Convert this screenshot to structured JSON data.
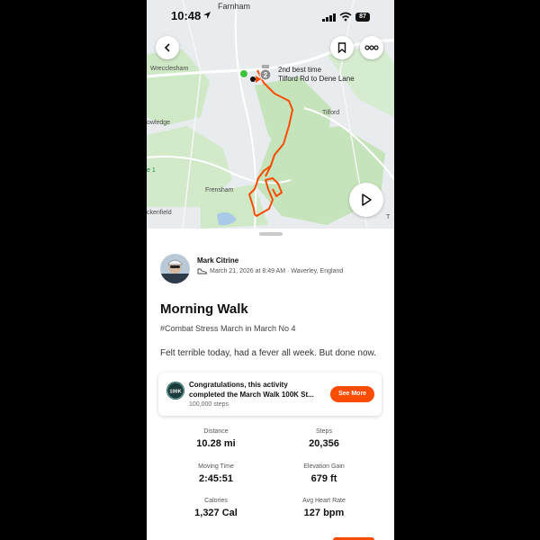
{
  "status": {
    "time": "10:48",
    "battery": "87"
  },
  "map": {
    "labels": {
      "farnham": "Farnham",
      "wrecclesham": "Wrecclesham",
      "tilford": "Tilford",
      "rowledge": "owledge",
      "frensham": "Frensham",
      "churt": "ckenfield",
      "route1": "e 1",
      "edge": "T"
    },
    "segment": {
      "rank": "2",
      "line1": "2nd best time",
      "line2": "Tilford Rd to Dene Lane"
    }
  },
  "activity": {
    "athlete": "Mark Citrine",
    "date_location": "March 21, 2026 at 8:49 AM · Waverley, England",
    "title": "Morning Walk",
    "tag": "#Combat Stress March in March No 4",
    "description": "Felt terrible today, had a fever all week. But done now."
  },
  "achievement": {
    "badge_text": "100K",
    "line1": "Congratulations, this activity",
    "line2": "completed the March Walk 100K St...",
    "sub": "100,000 steps",
    "button": "See More"
  },
  "stats": [
    {
      "label": "Distance",
      "value": "10.28 mi"
    },
    {
      "label": "Steps",
      "value": "20,356"
    },
    {
      "label": "Moving Time",
      "value": "2:45:51"
    },
    {
      "label": "Elevation Gain",
      "value": "679 ft"
    },
    {
      "label": "Calories",
      "value": "1,327 Cal"
    },
    {
      "label": "Avg Heart Rate",
      "value": "127 bpm"
    }
  ],
  "colors": {
    "accent": "#fc4c02",
    "map_green": "#c8e6c0",
    "map_bg": "#e9ecee"
  }
}
